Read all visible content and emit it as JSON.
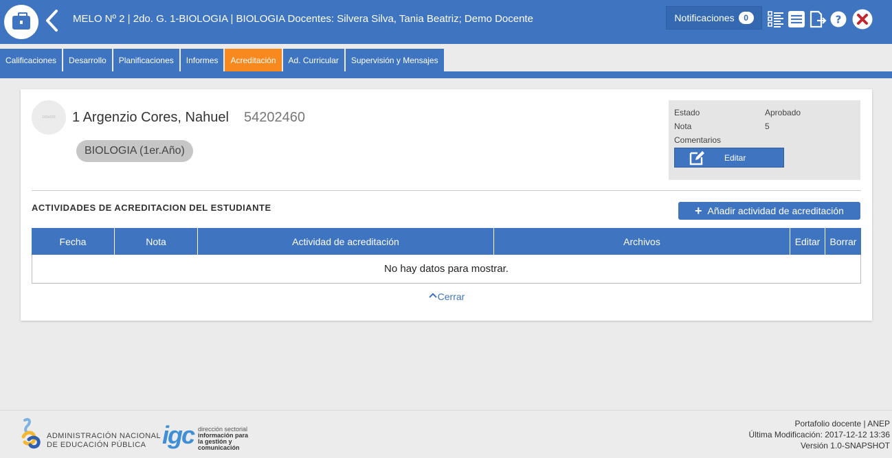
{
  "header": {
    "title": "MELO Nº 2 | 2do. G. 1-BIOLOGIA | BIOLOGIA Docentes: Silvera Silva, Tania Beatriz; Demo Docente",
    "notifications_label": "Notificaciones",
    "notifications_count": "0",
    "icons": [
      "briefcase-icon",
      "back-arrow-icon",
      "checklist-icon",
      "list-document-icon",
      "export-document-icon",
      "help-icon",
      "close-icon"
    ]
  },
  "tabs": [
    {
      "label": "Calificaciones",
      "active": false
    },
    {
      "label": "Desarrollo",
      "active": false
    },
    {
      "label": "Planificaciones",
      "active": false
    },
    {
      "label": "Informes",
      "active": false
    },
    {
      "label": "Acreditación",
      "active": true
    },
    {
      "label": "Ad. Curricular",
      "active": false
    },
    {
      "label": "Supervisión y Mensajes",
      "active": false
    }
  ],
  "student": {
    "avatar_text": "160x160",
    "name": "1 Argenzio Cores, Nahuel",
    "id": "54202460",
    "subject": "BIOLOGIA (1er.Año)"
  },
  "status_panel": {
    "estado_label": "Estado",
    "estado_value": "Aprobado",
    "nota_label": "Nota",
    "nota_value": "5",
    "comentarios_label": "Comentarios",
    "edit_label": "Editar"
  },
  "activities": {
    "title": "ACTIVIDADES DE ACREDITACION DEL ESTUDIANTE",
    "add_label": "Añadir actividad de acreditación",
    "columns": [
      "Fecha",
      "Nota",
      "Actividad de acreditación",
      "Archivos",
      "Editar",
      "Borrar"
    ],
    "empty_text": "No hay datos para mostrar.",
    "close_label": "Cerrar"
  },
  "footer": {
    "anep_line1": "ADMINISTRACIÓN NACIONAL",
    "anep_line2": "DE EDUCACIÓN PÚBLICA",
    "igc_logo": "igc",
    "igc_line1": "dirección sectorial",
    "igc_line2": "información para",
    "igc_line3": "la gestión y",
    "igc_line4": "comunicación",
    "product": "Portafolio docente | ANEP",
    "modified": "Última Modificación: 2017-12-12 13:36",
    "version": "Versión 1.0-SNAPSHOT"
  },
  "colors": {
    "primary": "#3f74c0",
    "active_tab": "#f7891f",
    "close_red": "#c0262e"
  }
}
